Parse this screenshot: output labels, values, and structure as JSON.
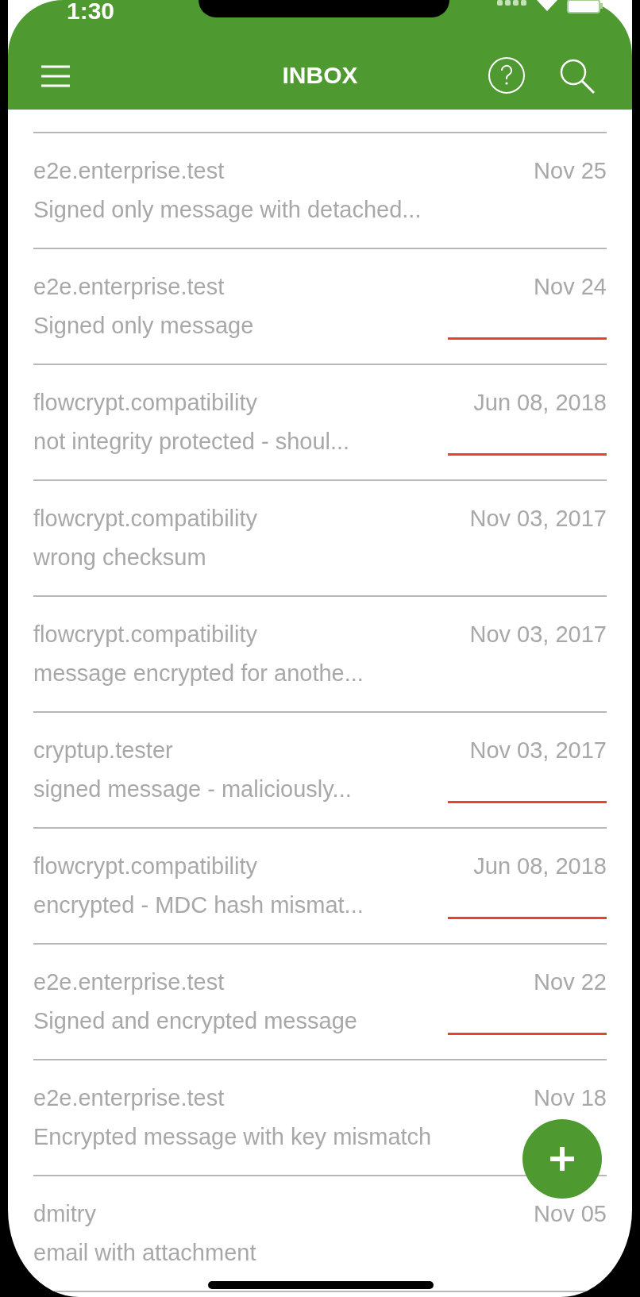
{
  "status_bar": {
    "time": "1:30"
  },
  "header": {
    "title": "INBOX"
  },
  "messages": [
    {
      "sender": "e2e.enterprise.test",
      "date": "Nov 25",
      "subject": "Signed only message with detached...",
      "marked": false
    },
    {
      "sender": "e2e.enterprise.test",
      "date": "Nov 24",
      "subject": "Signed only message",
      "marked": true
    },
    {
      "sender": "flowcrypt.compatibility",
      "date": "Jun 08, 2018",
      "subject": "not integrity protected - shoul...",
      "marked": true
    },
    {
      "sender": "flowcrypt.compatibility",
      "date": "Nov 03, 2017",
      "subject": "wrong checksum",
      "marked": false
    },
    {
      "sender": "flowcrypt.compatibility",
      "date": "Nov 03, 2017",
      "subject": "message encrypted for anothe...",
      "marked": false
    },
    {
      "sender": "cryptup.tester",
      "date": "Nov 03, 2017",
      "subject": "signed message - maliciously...",
      "marked": true
    },
    {
      "sender": "flowcrypt.compatibility",
      "date": "Jun 08, 2018",
      "subject": "encrypted - MDC hash mismat...",
      "marked": true
    },
    {
      "sender": "e2e.enterprise.test",
      "date": "Nov 22",
      "subject": "Signed and encrypted message",
      "marked": true
    },
    {
      "sender": "e2e.enterprise.test",
      "date": "Nov 18",
      "subject": "Encrypted message with key mismatch",
      "marked": false
    },
    {
      "sender": "dmitry",
      "date": "Nov 05",
      "subject": "email with attachment",
      "marked": false
    }
  ]
}
